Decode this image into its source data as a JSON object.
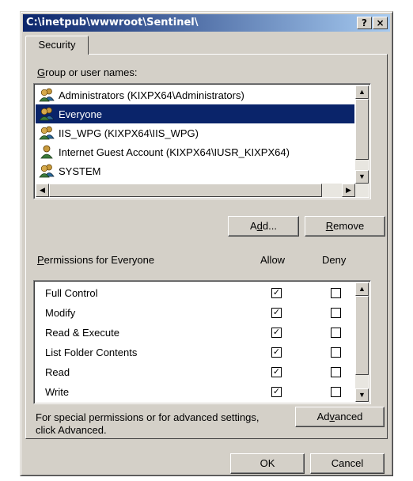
{
  "window": {
    "title": "C:\\inetpub\\wwwroot\\Sentinel\\",
    "help_glyph": "?",
    "close_glyph": "×"
  },
  "tab": {
    "label": "Security"
  },
  "group_section": {
    "label_prefix": "",
    "label_accel": "G",
    "label_rest": "roup or user names:",
    "users": [
      {
        "name": "Administrators (KIXPX64\\Administrators)",
        "selected": false,
        "icon": "user-group-icon"
      },
      {
        "name": "Everyone",
        "selected": true,
        "icon": "user-group-icon"
      },
      {
        "name": "IIS_WPG (KIXPX64\\IIS_WPG)",
        "selected": false,
        "icon": "user-group-icon"
      },
      {
        "name": "Internet Guest Account (KIXPX64\\IUSR_KIXPX64)",
        "selected": false,
        "icon": "user-icon"
      },
      {
        "name": "SYSTEM",
        "selected": false,
        "icon": "user-group-icon"
      }
    ]
  },
  "buttons": {
    "add_pre": "A",
    "add_accel": "d",
    "add_post": "d...",
    "remove_accel": "R",
    "remove_rest": "emove",
    "advanced_pre": "Ad",
    "advanced_accel": "v",
    "advanced_post": "anced",
    "ok": "OK",
    "cancel": "Cancel"
  },
  "permissions": {
    "label_accel": "P",
    "label_rest": "ermissions for Everyone",
    "allow_header": "Allow",
    "deny_header": "Deny",
    "rows": [
      {
        "name": "Full Control",
        "allow": true,
        "deny": false
      },
      {
        "name": "Modify",
        "allow": true,
        "deny": false
      },
      {
        "name": "Read & Execute",
        "allow": true,
        "deny": false
      },
      {
        "name": "List Folder Contents",
        "allow": true,
        "deny": false
      },
      {
        "name": "Read",
        "allow": true,
        "deny": false
      },
      {
        "name": "Write",
        "allow": true,
        "deny": false
      }
    ]
  },
  "advanced_note": {
    "line1": "For special permissions or for advanced settings,",
    "line2": "click Advanced."
  }
}
